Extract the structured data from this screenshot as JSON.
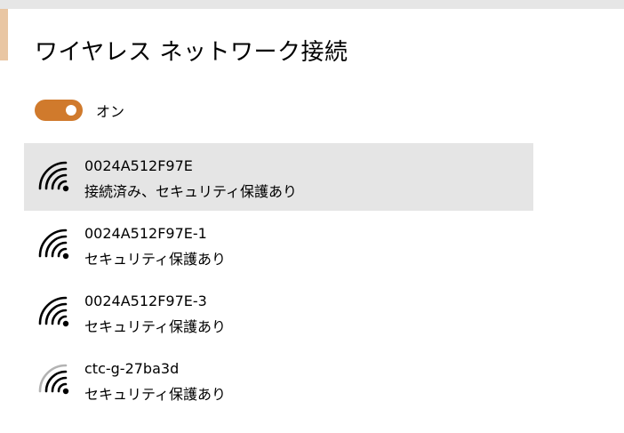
{
  "page": {
    "title": "ワイヤレス ネットワーク接続"
  },
  "toggle": {
    "state": "on",
    "label": "オン",
    "color": "#d07a2c"
  },
  "networks": [
    {
      "name": "0024A512F97E",
      "status": "接続済み、セキュリティ保護あり",
      "selected": true,
      "signal_bars": 4,
      "icon": "wifi-signal-full-icon"
    },
    {
      "name": "0024A512F97E-1",
      "status": "セキュリティ保護あり",
      "selected": false,
      "signal_bars": 4,
      "icon": "wifi-signal-full-icon"
    },
    {
      "name": "0024A512F97E-3",
      "status": "セキュリティ保護あり",
      "selected": false,
      "signal_bars": 4,
      "icon": "wifi-signal-full-icon"
    },
    {
      "name": "ctc-g-27ba3d",
      "status": "セキュリティ保護あり",
      "selected": false,
      "signal_bars": 3,
      "icon": "wifi-signal-3-bars-icon"
    }
  ],
  "colors": {
    "selected_background": "#e5e5e5",
    "weak_bar": "#b3b3b3"
  }
}
